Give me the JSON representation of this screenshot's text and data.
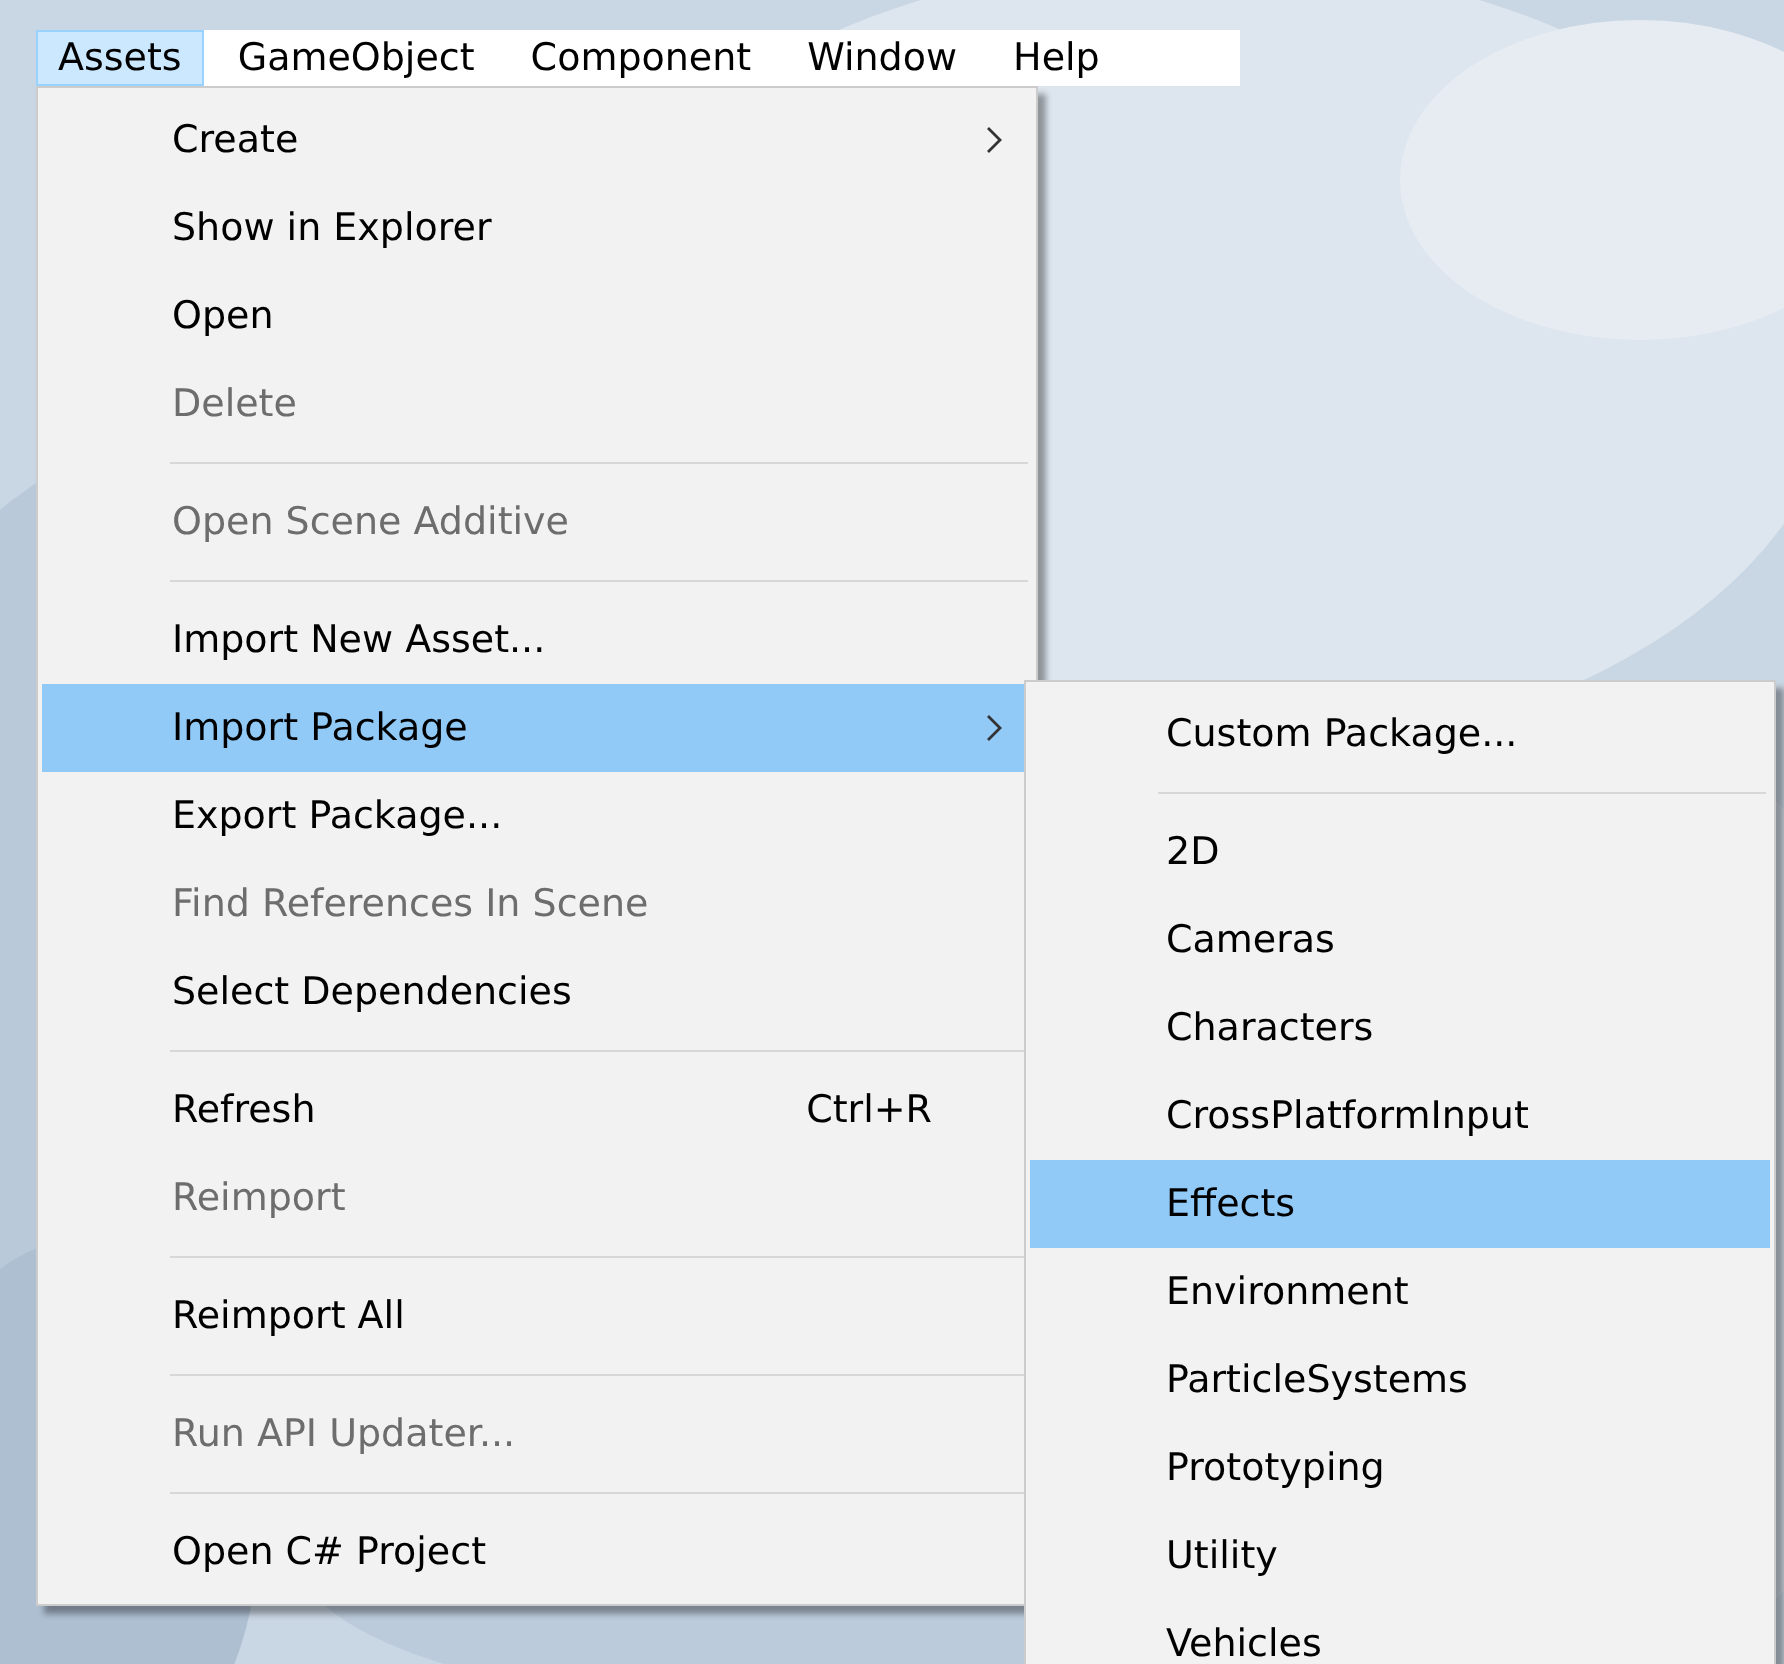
{
  "menu_bar": [
    {
      "label": "Assets",
      "selected": true
    },
    {
      "label": "GameObject",
      "selected": false
    },
    {
      "label": "Component",
      "selected": false
    },
    {
      "label": "Window",
      "selected": false
    },
    {
      "label": "Help",
      "selected": false
    }
  ],
  "menu": {
    "items": [
      {
        "kind": "item",
        "label": "Create",
        "has_submenu": true,
        "disabled": false,
        "selected": false
      },
      {
        "kind": "item",
        "label": "Show in Explorer",
        "has_submenu": false,
        "disabled": false,
        "selected": false
      },
      {
        "kind": "item",
        "label": "Open",
        "has_submenu": false,
        "disabled": false,
        "selected": false
      },
      {
        "kind": "item",
        "label": "Delete",
        "has_submenu": false,
        "disabled": true,
        "selected": false
      },
      {
        "kind": "separator"
      },
      {
        "kind": "item",
        "label": "Open Scene Additive",
        "has_submenu": false,
        "disabled": true,
        "selected": false
      },
      {
        "kind": "separator"
      },
      {
        "kind": "item",
        "label": "Import New Asset...",
        "has_submenu": false,
        "disabled": false,
        "selected": false
      },
      {
        "kind": "item",
        "label": "Import Package",
        "has_submenu": true,
        "disabled": false,
        "selected": true
      },
      {
        "kind": "item",
        "label": "Export Package...",
        "has_submenu": false,
        "disabled": false,
        "selected": false
      },
      {
        "kind": "item",
        "label": "Find References In Scene",
        "has_submenu": false,
        "disabled": true,
        "selected": false
      },
      {
        "kind": "item",
        "label": "Select Dependencies",
        "has_submenu": false,
        "disabled": false,
        "selected": false
      },
      {
        "kind": "separator"
      },
      {
        "kind": "item",
        "label": "Refresh",
        "shortcut": "Ctrl+R",
        "has_submenu": false,
        "disabled": false,
        "selected": false
      },
      {
        "kind": "item",
        "label": "Reimport",
        "has_submenu": false,
        "disabled": true,
        "selected": false
      },
      {
        "kind": "separator"
      },
      {
        "kind": "item",
        "label": "Reimport All",
        "has_submenu": false,
        "disabled": false,
        "selected": false
      },
      {
        "kind": "separator"
      },
      {
        "kind": "item",
        "label": "Run API Updater...",
        "has_submenu": false,
        "disabled": true,
        "selected": false
      },
      {
        "kind": "separator"
      },
      {
        "kind": "item",
        "label": "Open C# Project",
        "has_submenu": false,
        "disabled": false,
        "selected": false
      }
    ]
  },
  "submenu": {
    "items": [
      {
        "kind": "item",
        "label": "Custom Package...",
        "selected": false
      },
      {
        "kind": "separator"
      },
      {
        "kind": "item",
        "label": "2D",
        "selected": false
      },
      {
        "kind": "item",
        "label": "Cameras",
        "selected": false
      },
      {
        "kind": "item",
        "label": "Characters",
        "selected": false
      },
      {
        "kind": "item",
        "label": "CrossPlatformInput",
        "selected": false
      },
      {
        "kind": "item",
        "label": "Effects",
        "selected": true
      },
      {
        "kind": "item",
        "label": "Environment",
        "selected": false
      },
      {
        "kind": "item",
        "label": "ParticleSystems",
        "selected": false
      },
      {
        "kind": "item",
        "label": "Prototyping",
        "selected": false
      },
      {
        "kind": "item",
        "label": "Utility",
        "selected": false
      },
      {
        "kind": "item",
        "label": "Vehicles",
        "selected": false
      }
    ]
  }
}
